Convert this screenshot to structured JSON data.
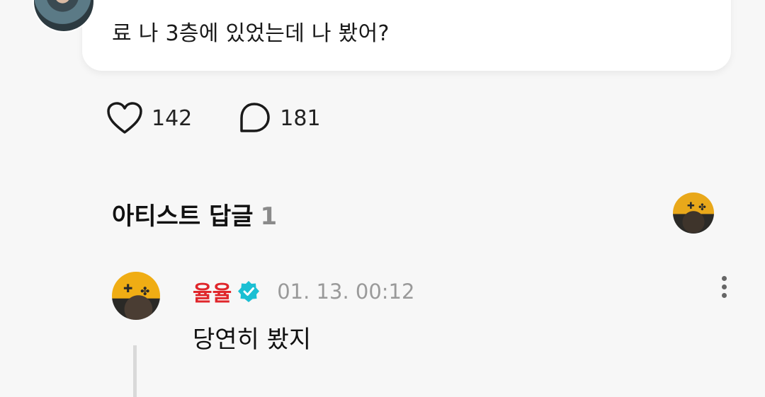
{
  "post": {
    "text": "료 나 3층에 있었는데 나 봤어?"
  },
  "actions": {
    "like_count": "142",
    "comment_count": "181"
  },
  "artist_replies": {
    "title": "아티스트 답글",
    "count": "1"
  },
  "reply": {
    "author": "율율",
    "timestamp": "01. 13. 00:12",
    "text": "당연히 봤지"
  },
  "colors": {
    "author_name": "#e0262b",
    "verified_badge": "#1bbfd3",
    "background": "#f7f7f7"
  },
  "icons": [
    "heart-icon",
    "comment-icon",
    "verified-badge-icon",
    "more-options-icon"
  ]
}
